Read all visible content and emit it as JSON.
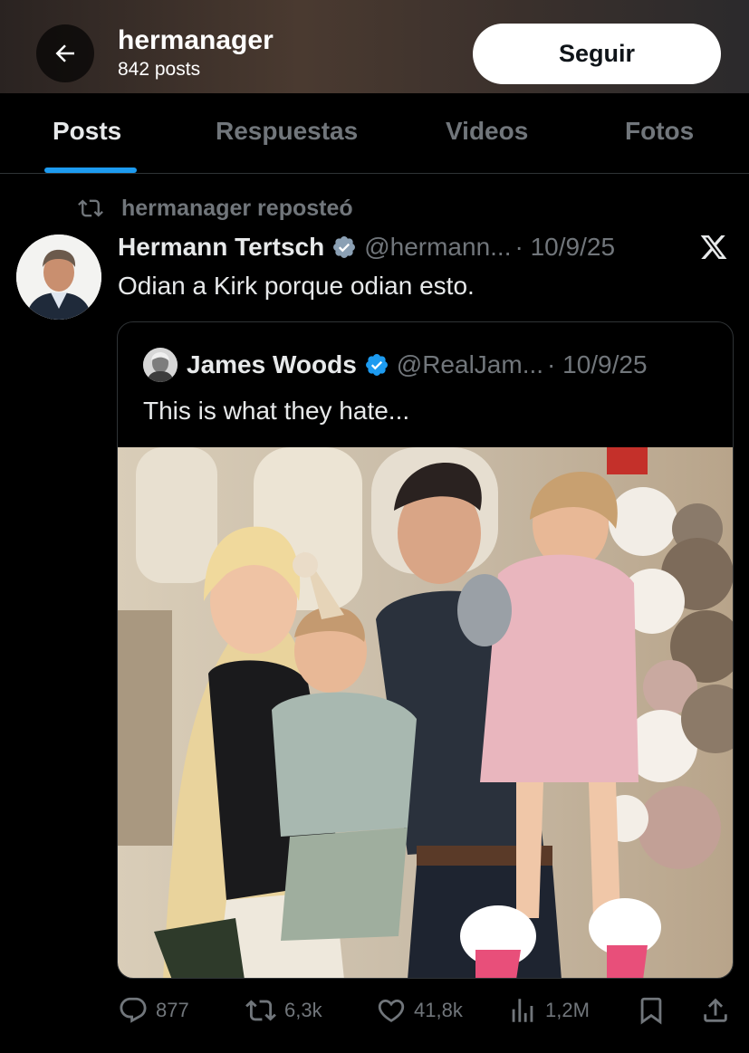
{
  "header": {
    "username": "hermanager",
    "posts_count": "842 posts",
    "follow_label": "Seguir"
  },
  "tabs": [
    {
      "label": "Posts",
      "active": true
    },
    {
      "label": "Respuestas",
      "active": false
    },
    {
      "label": "Videos",
      "active": false
    },
    {
      "label": "Fotos",
      "active": false
    }
  ],
  "repost": {
    "text": "hermanager reposteó"
  },
  "post": {
    "author": "Hermann Tertsch",
    "handle": "@hermann...",
    "date": "· 10/9/25",
    "text": "Odian a Kirk porque odian esto."
  },
  "quote": {
    "author": "James Woods",
    "handle": "@RealJam...",
    "date": "· 10/9/25",
    "text": "This is what they hate..."
  },
  "actions": {
    "replies": "877",
    "reposts": "6,3k",
    "likes": "41,8k",
    "views": "1,2M"
  },
  "colors": {
    "accent": "#1d9bf0",
    "muted": "#71767b",
    "text": "#e7e9ea",
    "border": "#2f3336"
  },
  "icons": [
    "back-arrow-icon",
    "repost-icon",
    "verified-badge-icon",
    "x-logo-icon",
    "reply-icon",
    "like-icon",
    "views-icon",
    "bookmark-icon",
    "share-icon"
  ]
}
